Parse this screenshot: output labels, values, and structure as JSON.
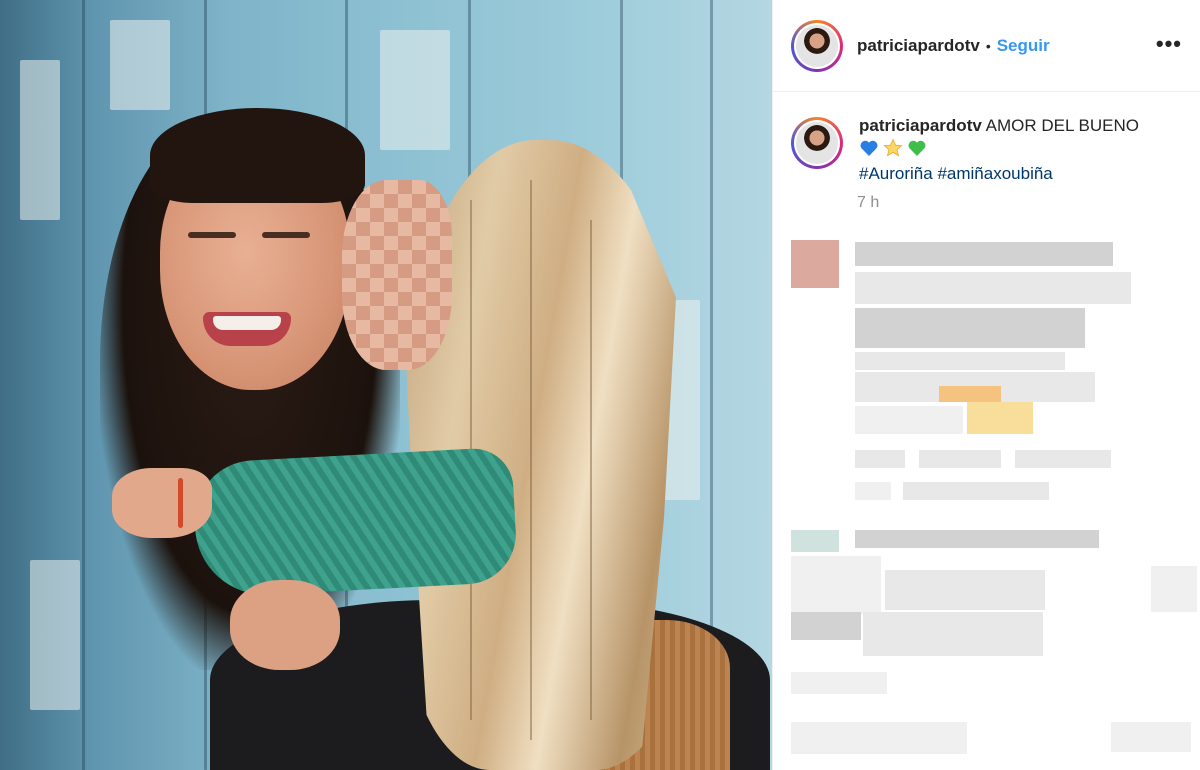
{
  "post": {
    "username": "patriciapardotv",
    "separator": "•",
    "follow_label": "Seguir",
    "more_label": "•••",
    "caption": {
      "username": "patriciapardotv",
      "text": "AMOR DEL BUENO",
      "emojis": [
        "blue-heart-icon",
        "star-icon",
        "green-heart-icon"
      ],
      "hashtag_1": "#Auroriña",
      "hashtag_2": "#amiñaxoubiña",
      "time": "7 h"
    }
  },
  "colors": {
    "link_blue": "#3897f0",
    "hashtag_blue": "#00376b",
    "text": "#262626",
    "muted": "#8e8e8e"
  }
}
